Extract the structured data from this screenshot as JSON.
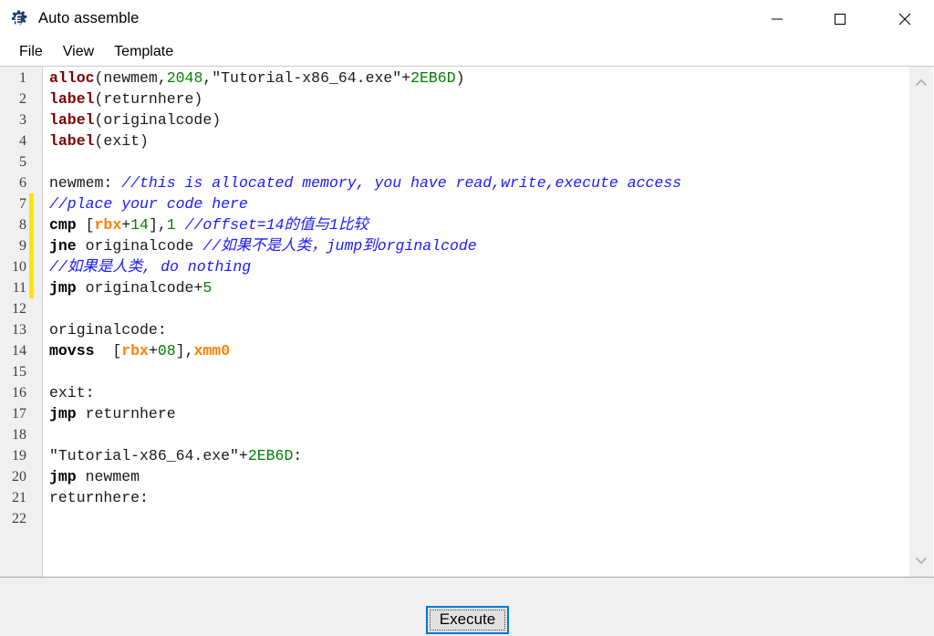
{
  "window": {
    "title": "Auto assemble",
    "icon": "cheat-engine-gear-icon",
    "controls": {
      "minimize": "—",
      "maximize": "☐",
      "close": "✕"
    }
  },
  "menubar": {
    "items": [
      {
        "label": "File"
      },
      {
        "label": "View"
      },
      {
        "label": "Template"
      }
    ]
  },
  "editor": {
    "line_numbers": [
      "1",
      "2",
      "3",
      "4",
      "5",
      "6",
      "7",
      "8",
      "9",
      "10",
      "11",
      "12",
      "13",
      "14",
      "15",
      "16",
      "17",
      "18",
      "19",
      "20",
      "21",
      "22"
    ],
    "modified_lines": [
      7,
      8,
      9,
      10,
      11
    ],
    "modified_marker_color": "#ffe400",
    "colors": {
      "keyword": "#800000",
      "mnemonic": "#000000",
      "number": "#008000",
      "register": "#ff8000",
      "comment": "#1a1aff",
      "plain": "#1a1a1a",
      "background": "#ffffff",
      "gutter": "#f0f0f0"
    },
    "lines": [
      {
        "n": "1",
        "text": "alloc(newmem,2048,\"Tutorial-x86_64.exe\"+2EB6D)"
      },
      {
        "n": "2",
        "text": "label(returnhere)"
      },
      {
        "n": "3",
        "text": "label(originalcode)"
      },
      {
        "n": "4",
        "text": "label(exit)"
      },
      {
        "n": "5",
        "text": ""
      },
      {
        "n": "6",
        "text": "newmem: //this is allocated memory, you have read,write,execute access"
      },
      {
        "n": "7",
        "text": "//place your code here"
      },
      {
        "n": "8",
        "text": "cmp [rbx+14],1 //offset=14的值与1比较"
      },
      {
        "n": "9",
        "text": "jne originalcode //如果不是人类，jump到orginalcode"
      },
      {
        "n": "10",
        "text": "//如果是人类, do nothing"
      },
      {
        "n": "11",
        "text": "jmp originalcode+5"
      },
      {
        "n": "12",
        "text": ""
      },
      {
        "n": "13",
        "text": "originalcode:"
      },
      {
        "n": "14",
        "text": "movss [rbx+08],xmm0"
      },
      {
        "n": "15",
        "text": ""
      },
      {
        "n": "16",
        "text": "exit:"
      },
      {
        "n": "17",
        "text": "jmp returnhere"
      },
      {
        "n": "18",
        "text": ""
      },
      {
        "n": "19",
        "text": "\"Tutorial-x86_64.exe\"+2EB6D:"
      },
      {
        "n": "20",
        "text": "jmp newmem"
      },
      {
        "n": "21",
        "text": "returnhere:"
      },
      {
        "n": "22",
        "text": ""
      }
    ],
    "tokens": [
      [
        {
          "t": "alloc",
          "c": "kw"
        },
        {
          "t": "(newmem,",
          "c": "pln"
        },
        {
          "t": "2048",
          "c": "num"
        },
        {
          "t": ",\"Tutorial-x86_64.exe\"+",
          "c": "pln"
        },
        {
          "t": "2EB6D",
          "c": "num"
        },
        {
          "t": ")",
          "c": "pln"
        }
      ],
      [
        {
          "t": "label",
          "c": "kw"
        },
        {
          "t": "(returnhere)",
          "c": "pln"
        }
      ],
      [
        {
          "t": "label",
          "c": "kw"
        },
        {
          "t": "(originalcode)",
          "c": "pln"
        }
      ],
      [
        {
          "t": "label",
          "c": "kw"
        },
        {
          "t": "(exit)",
          "c": "pln"
        }
      ],
      [],
      [
        {
          "t": "newmem: ",
          "c": "pln"
        },
        {
          "t": "//this is allocated memory, you have read,write,execute access",
          "c": "cmt"
        }
      ],
      [
        {
          "t": "//place your code here",
          "c": "cmt"
        }
      ],
      [
        {
          "t": "cmp",
          "c": "mn"
        },
        {
          "t": " [",
          "c": "pln"
        },
        {
          "t": "rbx",
          "c": "reg"
        },
        {
          "t": "+",
          "c": "pln"
        },
        {
          "t": "14",
          "c": "num"
        },
        {
          "t": "],",
          "c": "pln"
        },
        {
          "t": "1",
          "c": "num"
        },
        {
          "t": " ",
          "c": "pln"
        },
        {
          "t": "//offset=14的值与1比较",
          "c": "cmt"
        }
      ],
      [
        {
          "t": "jne",
          "c": "mn"
        },
        {
          "t": " originalcode ",
          "c": "pln"
        },
        {
          "t": "//如果不是人类，jump到orginalcode",
          "c": "cmt"
        }
      ],
      [
        {
          "t": "//如果是人类, do nothing",
          "c": "cmt"
        }
      ],
      [
        {
          "t": "jmp",
          "c": "mn"
        },
        {
          "t": " originalcode+",
          "c": "pln"
        },
        {
          "t": "5",
          "c": "num"
        }
      ],
      [],
      [
        {
          "t": "originalcode:",
          "c": "pln"
        }
      ],
      [
        {
          "t": "movss",
          "c": "mn"
        },
        {
          "t": "  [",
          "c": "pln"
        },
        {
          "t": "rbx",
          "c": "reg"
        },
        {
          "t": "+",
          "c": "pln"
        },
        {
          "t": "08",
          "c": "num"
        },
        {
          "t": "],",
          "c": "pln"
        },
        {
          "t": "xmm0",
          "c": "reg"
        }
      ],
      [],
      [
        {
          "t": "exit:",
          "c": "pln"
        }
      ],
      [
        {
          "t": "jmp",
          "c": "mn"
        },
        {
          "t": " returnhere",
          "c": "pln"
        }
      ],
      [],
      [
        {
          "t": "\"Tutorial-x86_64.exe\"+",
          "c": "pln"
        },
        {
          "t": "2EB6D",
          "c": "num"
        },
        {
          "t": ":",
          "c": "pln"
        }
      ],
      [
        {
          "t": "jmp",
          "c": "mn"
        },
        {
          "t": " newmem",
          "c": "pln"
        }
      ],
      [
        {
          "t": "returnhere:",
          "c": "pln"
        }
      ],
      []
    ]
  },
  "scrollbars": {
    "vertical": {
      "up_icon": "chevron-up-icon",
      "down_icon": "chevron-down-icon"
    },
    "horizontal": {
      "left_icon": "chevron-left-icon",
      "right_icon": "chevron-right-icon"
    }
  },
  "footer": {
    "execute_label": "Execute",
    "focus_color": "#0078d7"
  }
}
